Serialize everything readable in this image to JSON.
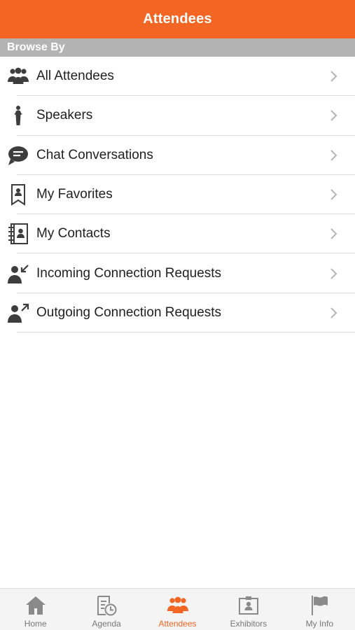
{
  "header": {
    "title": "Attendees"
  },
  "section": {
    "label": "Browse By"
  },
  "list": {
    "items": [
      {
        "label": "All Attendees",
        "icon": "group-icon"
      },
      {
        "label": "Speakers",
        "icon": "speaker-podium-icon"
      },
      {
        "label": "Chat Conversations",
        "icon": "chat-bubble-icon"
      },
      {
        "label": "My Favorites",
        "icon": "bookmark-person-icon"
      },
      {
        "label": "My Contacts",
        "icon": "address-book-icon"
      },
      {
        "label": "Incoming Connection Requests",
        "icon": "person-incoming-arrow-icon"
      },
      {
        "label": "Outgoing Connection Requests",
        "icon": "person-outgoing-arrow-icon"
      }
    ]
  },
  "tabbar": {
    "active": "Attendees",
    "tabs": [
      {
        "label": "Home",
        "icon": "home-icon"
      },
      {
        "label": "Agenda",
        "icon": "agenda-clock-icon"
      },
      {
        "label": "Attendees",
        "icon": "group-icon"
      },
      {
        "label": "Exhibitors",
        "icon": "badge-icon"
      },
      {
        "label": "My Info",
        "icon": "flag-icon"
      }
    ]
  },
  "colors": {
    "accent": "#f26522",
    "section_bar": "#b3b3b3",
    "icon": "#3d3d3d",
    "tab_inactive": "#8a8a8a"
  }
}
